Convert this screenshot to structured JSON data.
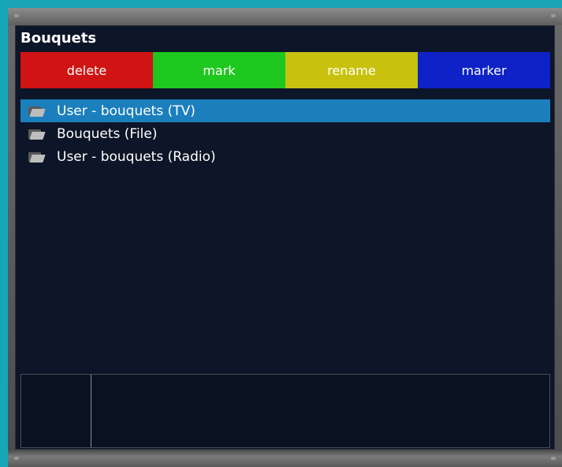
{
  "window": {
    "title": "Bouquets"
  },
  "color_buttons": {
    "red": {
      "label": "delete",
      "color": "#d01414"
    },
    "green": {
      "label": "mark",
      "color": "#1ec81e"
    },
    "yellow": {
      "label": "rename",
      "color": "#c8c20f"
    },
    "blue": {
      "label": "marker",
      "color": "#0e22c8"
    }
  },
  "list": {
    "items": [
      {
        "label": "User - bouquets (TV)",
        "icon": "folder-icon",
        "selected": true
      },
      {
        "label": "Bouquets (File)",
        "icon": "folder-icon",
        "selected": false
      },
      {
        "label": "User - bouquets (Radio)",
        "icon": "folder-icon",
        "selected": false
      }
    ],
    "selection_color": "#1c7fbd"
  }
}
